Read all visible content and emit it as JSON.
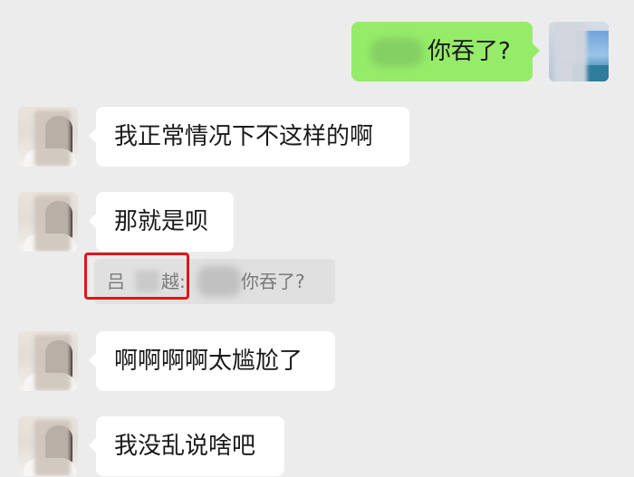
{
  "messages": [
    {
      "sender": "self",
      "text": "你吞了?"
    },
    {
      "sender": "other",
      "text": "我正常情况下不这样的啊"
    },
    {
      "sender": "other",
      "text": "那就是呗"
    },
    {
      "sender": "other",
      "text": "啊啊啊啊太尴尬了"
    },
    {
      "sender": "other",
      "text": "我没乱说啥吧"
    }
  ],
  "quote": {
    "sender_prefix": "吕",
    "sender_suffix": "越:",
    "text": "你吞了?"
  },
  "colors": {
    "chat_background": "#ececec",
    "self_bubble": "#95ec69",
    "other_bubble": "#ffffff",
    "quote_background": "#e0e0e0",
    "highlight": "#e0161b"
  }
}
